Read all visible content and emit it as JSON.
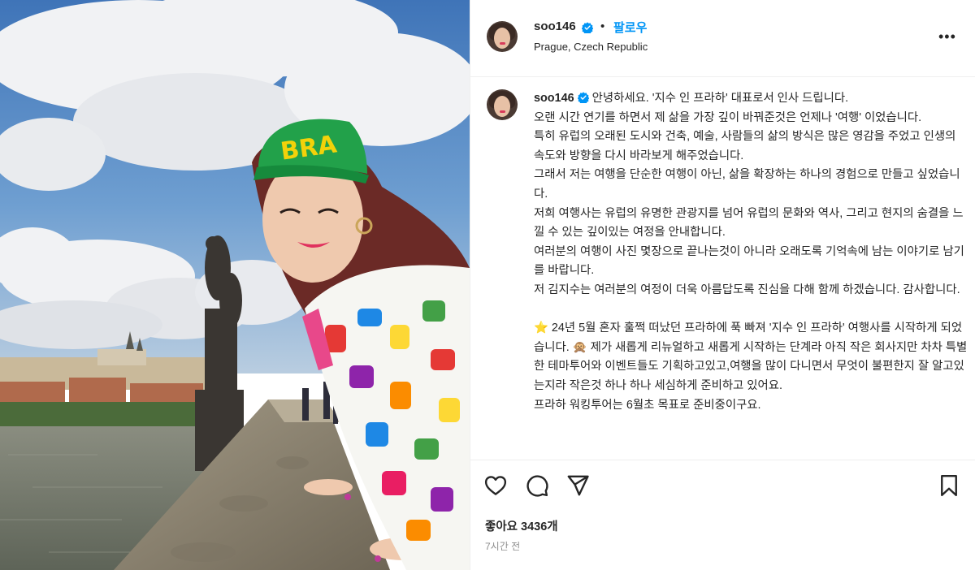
{
  "post": {
    "username": "soo146",
    "follow_label": "팔로우",
    "separator": "•",
    "location": "Prague, Czech Republic",
    "more_label": "•••"
  },
  "photo": {
    "cap_text": "BRA"
  },
  "caption": {
    "username": "soo146",
    "lines": [
      "안녕하세요. '지수 인 프라하' 대표로서 인사 드립니다.",
      "오랜 시간 연기를 하면서 제 삶을 가장 깊이 바꿔준것은 언제나 '여행' 이었습니다.",
      "특히 유럽의 오래된 도시와 건축, 예술, 사람들의 삶의 방식은 많은 영감을 주었고 인생의 속도와 방향을 다시 바라보게 해주었습니다.",
      "그래서 저는 여행을 단순한 여행이 아닌, 삶을 확장하는 하나의 경험으로 만들고 싶었습니다.",
      "저희 여행사는 유럽의 유명한 관광지를 넘어 유럽의 문화와 역사, 그리고 현지의 숨결을 느낄 수 있는 깊이있는 여정을 안내합니다.",
      "여러분의 여행이 사진 몇장으로 끝나는것이 아니라 오래도록 기억속에 남는 이야기로 남기를 바랍니다.",
      "저 김지수는 여러분의 여정이 더욱 아름답도록 진심을 다해 함께 하겠습니다. 감사합니다."
    ],
    "star_emoji": "⭐",
    "monkey_emoji": "🙊",
    "para2_a": " 24년 5월 혼자 훌쩍 떠났던 프라하에 푹 빠져 '지수 인 프라하' 여행사를 시작하게 되었습니다. ",
    "para2_b": " 제가 새롭게 리뉴얼하고 새롭게 시작하는 단계라 아직 작은 회사지만 차차 특별한 테마투어와 이벤트들도 기획하고있고,여행을 많이 다니면서 무엇이 불편한지 잘 알고있는지라 작은것 하나 하나 세심하게 준비하고 있어요.",
    "para3": "프라하 워킹투어는 6월초 목표로 준비중이구요."
  },
  "actions": {
    "like_icon": "heart-icon",
    "comment_icon": "comment-icon",
    "share_icon": "send-icon",
    "save_icon": "bookmark-icon",
    "likes": "좋아요 3436개",
    "timestamp": "7시간 전"
  },
  "colors": {
    "accent": "#0095f6",
    "text": "#262626",
    "muted": "#8e8e8e"
  }
}
